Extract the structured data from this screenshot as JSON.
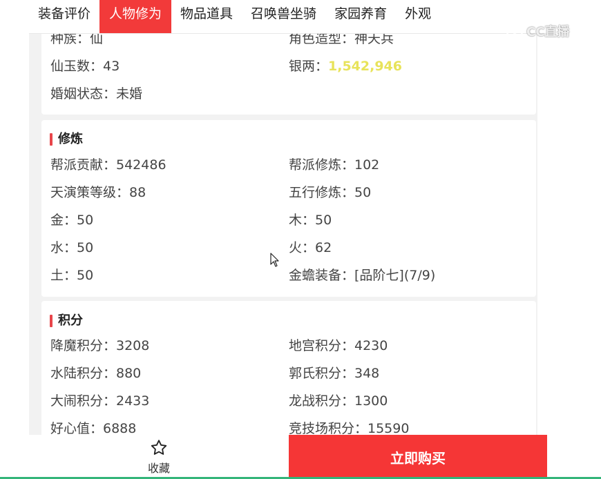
{
  "tabs": [
    {
      "label": "装备评价",
      "active": false
    },
    {
      "label": "人物修为",
      "active": true
    },
    {
      "label": "物品道具",
      "active": false
    },
    {
      "label": "召唤兽坐骑",
      "active": false
    },
    {
      "label": "家园养育",
      "active": false
    },
    {
      "label": "外观",
      "active": false
    }
  ],
  "basic": {
    "rows": [
      {
        "l": "种族：仙",
        "r": "角色造型：神天兵"
      },
      {
        "l": "仙玉数：43",
        "r_label": "银两：",
        "r_value": "1,542,946"
      },
      {
        "l": "婚姻状态：未婚"
      }
    ],
    "silver_color": "#e8e35a"
  },
  "cultivation": {
    "title": "修炼",
    "rows": [
      {
        "l": "帮派贡献：542486",
        "r": "帮派修炼：102"
      },
      {
        "l": "天演策等级：88",
        "r": "五行修炼：50"
      },
      {
        "l": "金：50",
        "r": "木：50"
      },
      {
        "l": "水：50",
        "r": "火：62"
      },
      {
        "l": "土：50",
        "r": "金蟾装备：[品阶七](7/9)"
      }
    ]
  },
  "points": {
    "title": "积分",
    "rows": [
      {
        "l": "降魔积分：3208",
        "r": "地宫积分：4230"
      },
      {
        "l": "水陆积分：880",
        "r": "郭氏积分：348"
      },
      {
        "l": "大闹积分：2433",
        "r": "龙战积分：1300"
      },
      {
        "l": "好心值：6888",
        "r": "竞技场积分：15590"
      }
    ]
  },
  "bottom": {
    "favorite_label": "收藏",
    "favorite_icon": "star-outline-icon",
    "buy_label": "立即购买",
    "buy_color": "#f53636"
  },
  "watermark": {
    "text": "CC直播",
    "icon": "cc-live-logo-icon"
  },
  "accent_color": "#f23a3a"
}
